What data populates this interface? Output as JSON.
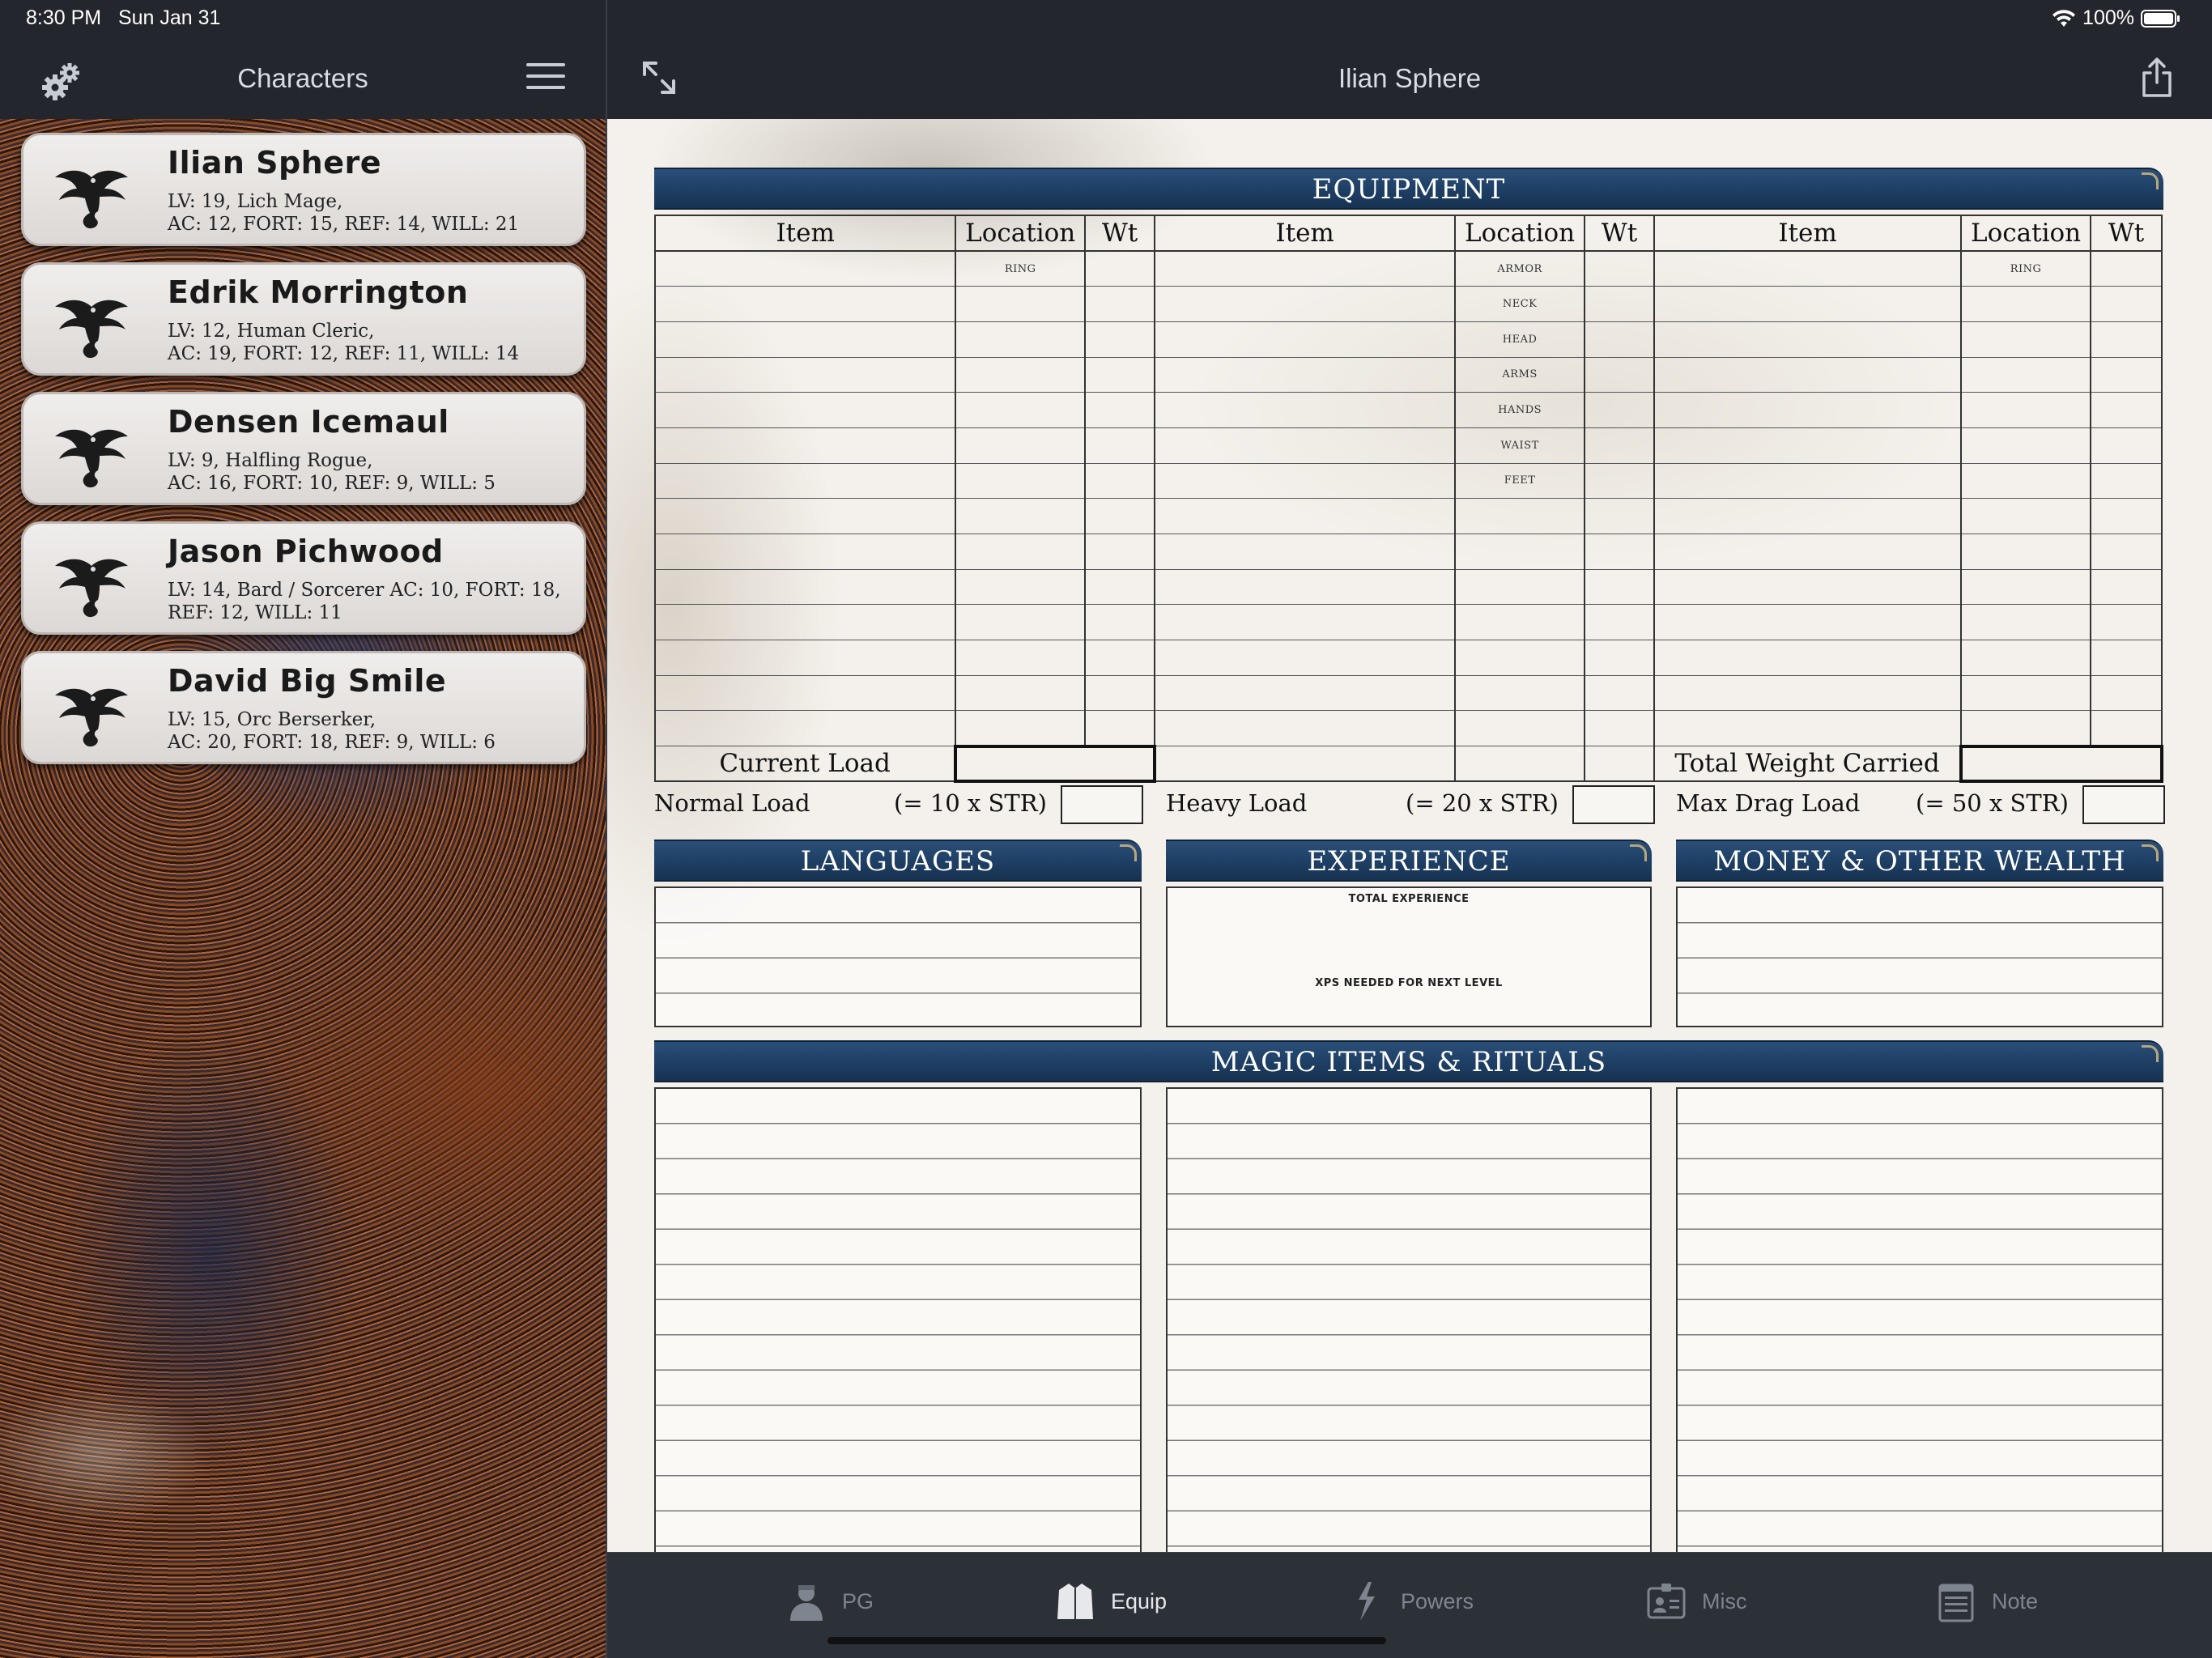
{
  "status_bar": {
    "time": "8:30 PM",
    "date": "Sun Jan 31",
    "battery": "100%"
  },
  "left": {
    "title": "Characters",
    "characters": [
      {
        "name": "Ilian Sphere",
        "info": "LV: 19, Lich  Mage,\nAC: 12, FORT: 15, REF: 14, WILL: 21"
      },
      {
        "name": "Edrik Morrington",
        "info": "LV: 12, Human  Cleric,\nAC: 19, FORT: 12, REF: 11, WILL: 14"
      },
      {
        "name": "Densen Icemaul",
        "info": "LV: 9, Halfling  Rogue,\nAC: 16, FORT: 10, REF: 9, WILL: 5"
      },
      {
        "name": "Jason Pichwood",
        "info": "LV: 14, Bard / Sorcerer  AC: 10, FORT: 18,\nREF: 12, WILL: 11"
      },
      {
        "name": "David Big Smile",
        "info": "LV: 15, Orc  Berserker,\nAC: 20, FORT: 18, REF: 9, WILL: 6"
      }
    ]
  },
  "document": {
    "title": "Ilian Sphere",
    "equipment": {
      "banner": "EQUIPMENT",
      "col_item": "Item",
      "col_location": "Location",
      "col_wt": "Wt",
      "slots_left": [
        "RING"
      ],
      "slots_mid": [
        "ARMOR",
        "NECK",
        "HEAD",
        "ARMS",
        "HANDS",
        "WAIST",
        "FEET"
      ],
      "slots_right": [
        "RING"
      ],
      "current_load": "Current Load",
      "total_weight": "Total Weight Carried"
    },
    "loads": [
      {
        "label": "Normal Load",
        "formula": "(= 10 x STR)"
      },
      {
        "label": "Heavy Load",
        "formula": "(= 20 x STR)"
      },
      {
        "label": "Max Drag Load",
        "formula": "(= 50 x STR)"
      }
    ],
    "languages_banner": "LANGUAGES",
    "experience_banner": "EXPERIENCE",
    "experience_total": "TOTAL EXPERIENCE",
    "experience_next": "XPS NEEDED FOR NEXT LEVEL",
    "money_banner": "MONEY & OTHER WEALTH",
    "magic_banner": "MAGIC ITEMS & RITUALS"
  },
  "tabs": [
    {
      "label": "PG",
      "icon": "person-icon",
      "active": false
    },
    {
      "label": "Equip",
      "icon": "jacket-icon",
      "active": true
    },
    {
      "label": "Powers",
      "icon": "lightning-hand-icon",
      "active": false
    },
    {
      "label": "Misc",
      "icon": "id-badge-icon",
      "active": false
    },
    {
      "label": "Note",
      "icon": "notepad-icon",
      "active": false
    }
  ],
  "colors": {
    "banner": "#1d3d62",
    "chrome": "#23262d",
    "tab_active": "#e6e8ec",
    "tab_inactive": "#7f858f"
  }
}
